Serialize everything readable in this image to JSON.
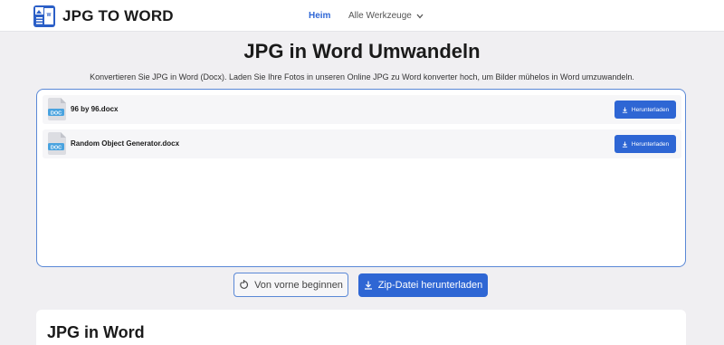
{
  "header": {
    "logo_text": "JPG TO WORD",
    "nav": {
      "home": "Heim",
      "tools": "Alle Werkzeuge"
    }
  },
  "main": {
    "title": "JPG in Word Umwandeln",
    "subtitle": "Konvertieren Sie JPG in Word (Docx). Laden Sie Ihre Fotos in unseren Online JPG zu Word konverter hoch, um Bilder mühelos in Word umzuwandeln."
  },
  "files": [
    {
      "name": "96 by 96.docx",
      "button": "Herunterladen"
    },
    {
      "name": "Random Object Generator.docx",
      "button": "Herunterladen"
    }
  ],
  "file_icon_label": "DOC",
  "actions": {
    "restart": "Von vorne beginnen",
    "zip": "Zip-Datei herunterladen"
  },
  "section": {
    "title": "JPG in Word"
  },
  "colors": {
    "accent": "#2e66d4",
    "panel_border": "#5a88d6",
    "background": "#f0eff2"
  }
}
